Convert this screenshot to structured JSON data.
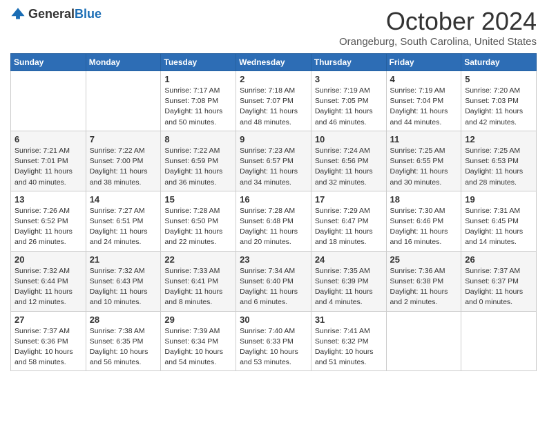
{
  "logo": {
    "text_general": "General",
    "text_blue": "Blue"
  },
  "header": {
    "month": "October 2024",
    "location": "Orangeburg, South Carolina, United States"
  },
  "weekdays": [
    "Sunday",
    "Monday",
    "Tuesday",
    "Wednesday",
    "Thursday",
    "Friday",
    "Saturday"
  ],
  "weeks": [
    [
      {
        "day": "",
        "sunrise": "",
        "sunset": "",
        "daylight": ""
      },
      {
        "day": "",
        "sunrise": "",
        "sunset": "",
        "daylight": ""
      },
      {
        "day": "1",
        "sunrise": "Sunrise: 7:17 AM",
        "sunset": "Sunset: 7:08 PM",
        "daylight": "Daylight: 11 hours and 50 minutes."
      },
      {
        "day": "2",
        "sunrise": "Sunrise: 7:18 AM",
        "sunset": "Sunset: 7:07 PM",
        "daylight": "Daylight: 11 hours and 48 minutes."
      },
      {
        "day": "3",
        "sunrise": "Sunrise: 7:19 AM",
        "sunset": "Sunset: 7:05 PM",
        "daylight": "Daylight: 11 hours and 46 minutes."
      },
      {
        "day": "4",
        "sunrise": "Sunrise: 7:19 AM",
        "sunset": "Sunset: 7:04 PM",
        "daylight": "Daylight: 11 hours and 44 minutes."
      },
      {
        "day": "5",
        "sunrise": "Sunrise: 7:20 AM",
        "sunset": "Sunset: 7:03 PM",
        "daylight": "Daylight: 11 hours and 42 minutes."
      }
    ],
    [
      {
        "day": "6",
        "sunrise": "Sunrise: 7:21 AM",
        "sunset": "Sunset: 7:01 PM",
        "daylight": "Daylight: 11 hours and 40 minutes."
      },
      {
        "day": "7",
        "sunrise": "Sunrise: 7:22 AM",
        "sunset": "Sunset: 7:00 PM",
        "daylight": "Daylight: 11 hours and 38 minutes."
      },
      {
        "day": "8",
        "sunrise": "Sunrise: 7:22 AM",
        "sunset": "Sunset: 6:59 PM",
        "daylight": "Daylight: 11 hours and 36 minutes."
      },
      {
        "day": "9",
        "sunrise": "Sunrise: 7:23 AM",
        "sunset": "Sunset: 6:57 PM",
        "daylight": "Daylight: 11 hours and 34 minutes."
      },
      {
        "day": "10",
        "sunrise": "Sunrise: 7:24 AM",
        "sunset": "Sunset: 6:56 PM",
        "daylight": "Daylight: 11 hours and 32 minutes."
      },
      {
        "day": "11",
        "sunrise": "Sunrise: 7:25 AM",
        "sunset": "Sunset: 6:55 PM",
        "daylight": "Daylight: 11 hours and 30 minutes."
      },
      {
        "day": "12",
        "sunrise": "Sunrise: 7:25 AM",
        "sunset": "Sunset: 6:53 PM",
        "daylight": "Daylight: 11 hours and 28 minutes."
      }
    ],
    [
      {
        "day": "13",
        "sunrise": "Sunrise: 7:26 AM",
        "sunset": "Sunset: 6:52 PM",
        "daylight": "Daylight: 11 hours and 26 minutes."
      },
      {
        "day": "14",
        "sunrise": "Sunrise: 7:27 AM",
        "sunset": "Sunset: 6:51 PM",
        "daylight": "Daylight: 11 hours and 24 minutes."
      },
      {
        "day": "15",
        "sunrise": "Sunrise: 7:28 AM",
        "sunset": "Sunset: 6:50 PM",
        "daylight": "Daylight: 11 hours and 22 minutes."
      },
      {
        "day": "16",
        "sunrise": "Sunrise: 7:28 AM",
        "sunset": "Sunset: 6:48 PM",
        "daylight": "Daylight: 11 hours and 20 minutes."
      },
      {
        "day": "17",
        "sunrise": "Sunrise: 7:29 AM",
        "sunset": "Sunset: 6:47 PM",
        "daylight": "Daylight: 11 hours and 18 minutes."
      },
      {
        "day": "18",
        "sunrise": "Sunrise: 7:30 AM",
        "sunset": "Sunset: 6:46 PM",
        "daylight": "Daylight: 11 hours and 16 minutes."
      },
      {
        "day": "19",
        "sunrise": "Sunrise: 7:31 AM",
        "sunset": "Sunset: 6:45 PM",
        "daylight": "Daylight: 11 hours and 14 minutes."
      }
    ],
    [
      {
        "day": "20",
        "sunrise": "Sunrise: 7:32 AM",
        "sunset": "Sunset: 6:44 PM",
        "daylight": "Daylight: 11 hours and 12 minutes."
      },
      {
        "day": "21",
        "sunrise": "Sunrise: 7:32 AM",
        "sunset": "Sunset: 6:43 PM",
        "daylight": "Daylight: 11 hours and 10 minutes."
      },
      {
        "day": "22",
        "sunrise": "Sunrise: 7:33 AM",
        "sunset": "Sunset: 6:41 PM",
        "daylight": "Daylight: 11 hours and 8 minutes."
      },
      {
        "day": "23",
        "sunrise": "Sunrise: 7:34 AM",
        "sunset": "Sunset: 6:40 PM",
        "daylight": "Daylight: 11 hours and 6 minutes."
      },
      {
        "day": "24",
        "sunrise": "Sunrise: 7:35 AM",
        "sunset": "Sunset: 6:39 PM",
        "daylight": "Daylight: 11 hours and 4 minutes."
      },
      {
        "day": "25",
        "sunrise": "Sunrise: 7:36 AM",
        "sunset": "Sunset: 6:38 PM",
        "daylight": "Daylight: 11 hours and 2 minutes."
      },
      {
        "day": "26",
        "sunrise": "Sunrise: 7:37 AM",
        "sunset": "Sunset: 6:37 PM",
        "daylight": "Daylight: 11 hours and 0 minutes."
      }
    ],
    [
      {
        "day": "27",
        "sunrise": "Sunrise: 7:37 AM",
        "sunset": "Sunset: 6:36 PM",
        "daylight": "Daylight: 10 hours and 58 minutes."
      },
      {
        "day": "28",
        "sunrise": "Sunrise: 7:38 AM",
        "sunset": "Sunset: 6:35 PM",
        "daylight": "Daylight: 10 hours and 56 minutes."
      },
      {
        "day": "29",
        "sunrise": "Sunrise: 7:39 AM",
        "sunset": "Sunset: 6:34 PM",
        "daylight": "Daylight: 10 hours and 54 minutes."
      },
      {
        "day": "30",
        "sunrise": "Sunrise: 7:40 AM",
        "sunset": "Sunset: 6:33 PM",
        "daylight": "Daylight: 10 hours and 53 minutes."
      },
      {
        "day": "31",
        "sunrise": "Sunrise: 7:41 AM",
        "sunset": "Sunset: 6:32 PM",
        "daylight": "Daylight: 10 hours and 51 minutes."
      },
      {
        "day": "",
        "sunrise": "",
        "sunset": "",
        "daylight": ""
      },
      {
        "day": "",
        "sunrise": "",
        "sunset": "",
        "daylight": ""
      }
    ]
  ]
}
